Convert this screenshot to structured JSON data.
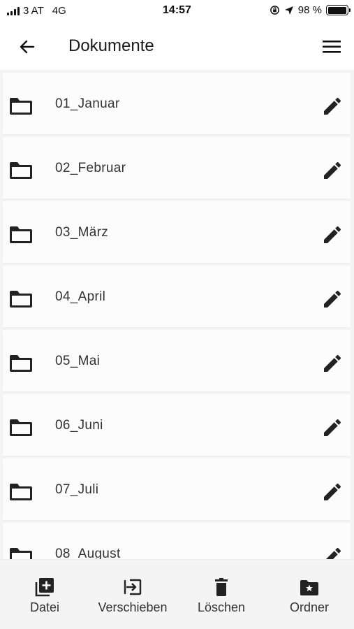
{
  "status_bar": {
    "carrier": "3 AT",
    "network": "4G",
    "time": "14:57",
    "battery": "98 %",
    "battery_level": 0.98
  },
  "header": {
    "title": "Dokumente",
    "back_icon": "arrow-left-icon",
    "menu_icon": "hamburger-menu-icon"
  },
  "folders": [
    {
      "name": "01_Januar"
    },
    {
      "name": "02_Februar"
    },
    {
      "name": "03_März"
    },
    {
      "name": "04_April"
    },
    {
      "name": "05_Mai"
    },
    {
      "name": "06_Juni"
    },
    {
      "name": "07_Juli"
    },
    {
      "name": "08_August"
    }
  ],
  "toolbar": {
    "file_label": "Datei",
    "move_label": "Verschieben",
    "delete_label": "Löschen",
    "folder_label": "Ordner"
  }
}
